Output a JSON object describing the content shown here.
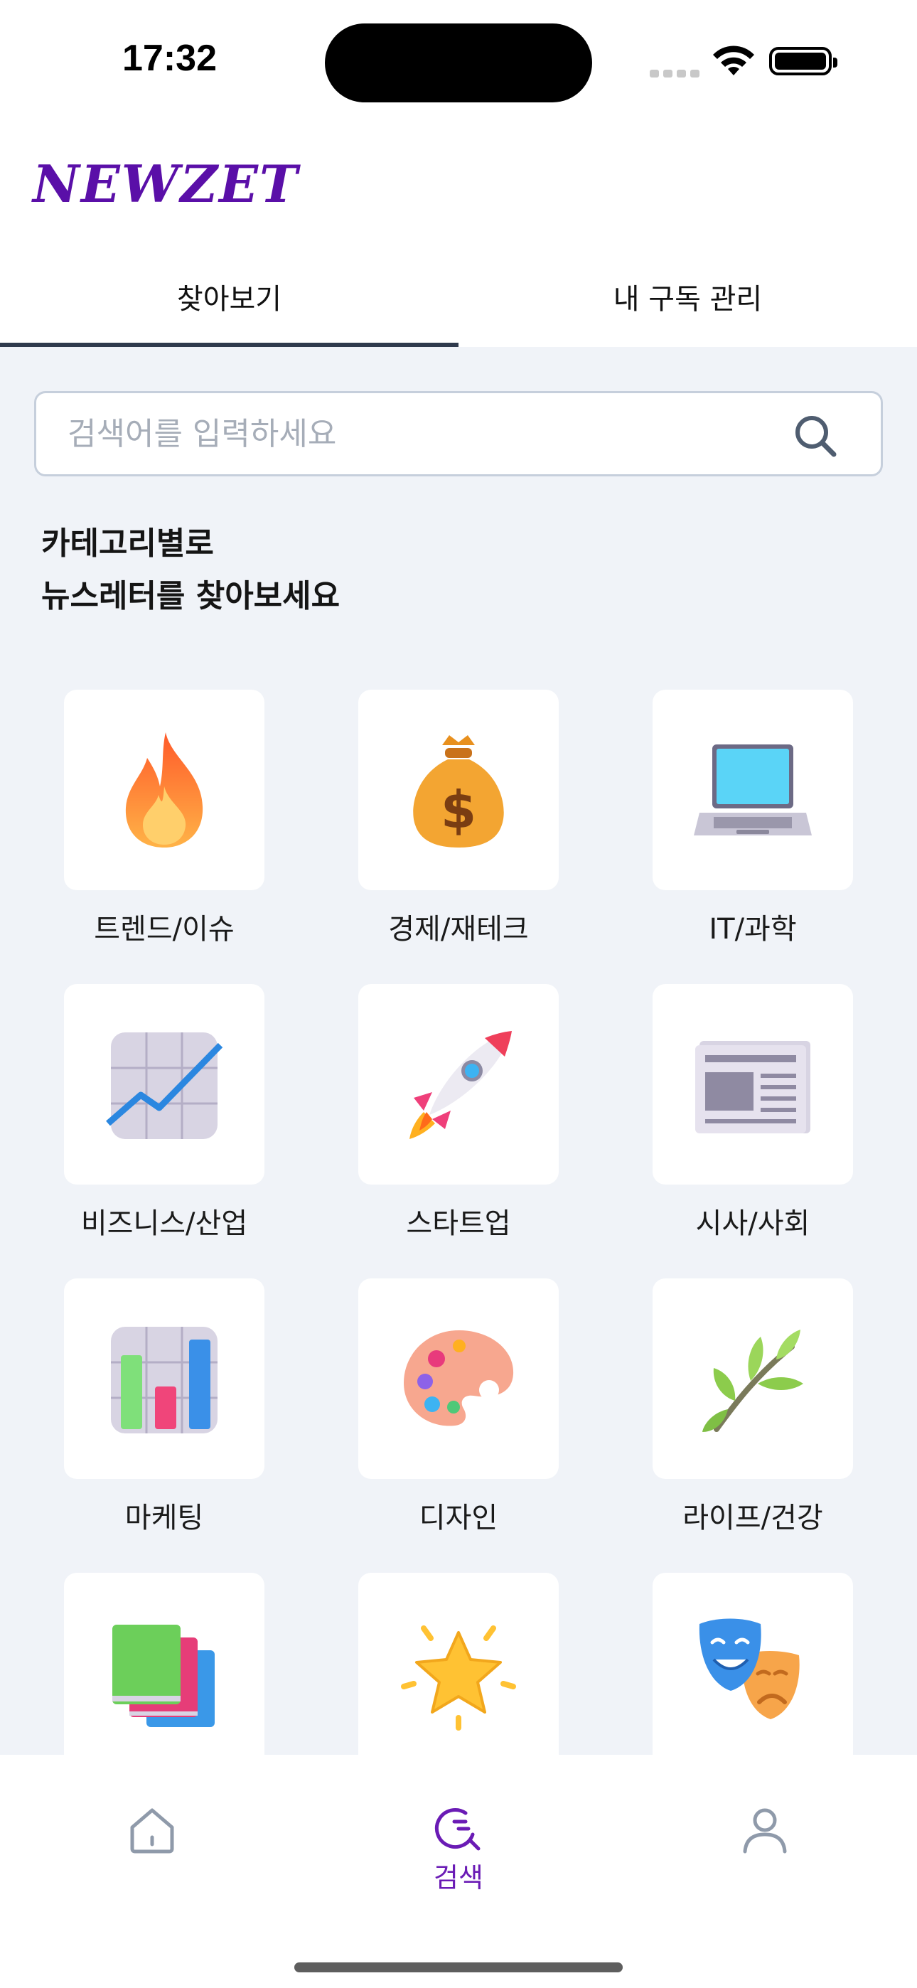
{
  "status_bar": {
    "time": "17:32"
  },
  "header": {
    "logo": "NEWZET",
    "tabs": [
      {
        "label": "찾아보기",
        "active": true
      },
      {
        "label": "내 구독 관리",
        "active": false
      }
    ]
  },
  "search": {
    "placeholder": "검색어를 입력하세요",
    "value": ""
  },
  "section": {
    "title_line1": "카테고리별로",
    "title_line2": "뉴스레터를 찾아보세요"
  },
  "categories": [
    {
      "label": "트렌드/이슈",
      "icon": "fire-icon"
    },
    {
      "label": "경제/재테크",
      "icon": "money-bag-icon"
    },
    {
      "label": "IT/과학",
      "icon": "laptop-icon"
    },
    {
      "label": "비즈니스/산업",
      "icon": "chart-increasing-icon"
    },
    {
      "label": "스타트업",
      "icon": "rocket-icon"
    },
    {
      "label": "시사/사회",
      "icon": "newspaper-icon"
    },
    {
      "label": "마케팅",
      "icon": "bar-chart-icon"
    },
    {
      "label": "디자인",
      "icon": "palette-icon"
    },
    {
      "label": "라이프/건강",
      "icon": "herb-icon"
    },
    {
      "label": "",
      "icon": "books-icon"
    },
    {
      "label": "",
      "icon": "star-icon"
    },
    {
      "label": "",
      "icon": "theater-masks-icon"
    }
  ],
  "bottom_nav": {
    "items": [
      {
        "label": "",
        "icon": "home-icon"
      },
      {
        "label": "검색",
        "icon": "search-icon",
        "active": true
      },
      {
        "label": "",
        "icon": "profile-icon"
      }
    ]
  },
  "colors": {
    "brand": "#5a0fa8",
    "background": "#f0f3f8",
    "tab_indicator": "#2f3a4d"
  }
}
